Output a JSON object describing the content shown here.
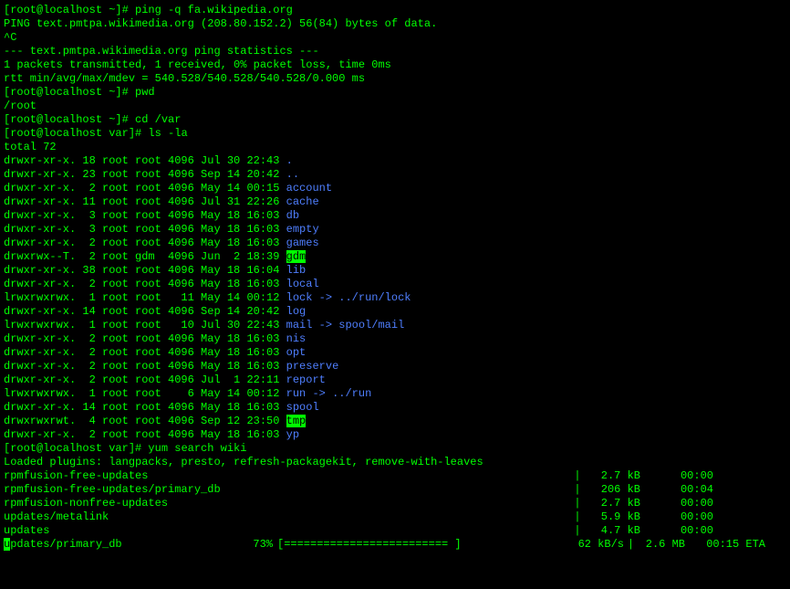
{
  "prompt_home": "[root@localhost ~]#",
  "prompt_var": "[root@localhost var]#",
  "cmd_ping": " ping -q fa.wikipedia.org",
  "ping_header": "PING text.pmtpa.wikimedia.org (208.80.152.2) 56(84) bytes of data.",
  "ctrl_c": "^C",
  "ping_stats_header": "--- text.pmtpa.wikimedia.org ping statistics ---",
  "ping_stats1": "1 packets transmitted, 1 received, 0% packet loss, time 0ms",
  "ping_stats2": "rtt min/avg/max/mdev = 540.528/540.528/540.528/0.000 ms",
  "cmd_pwd": " pwd",
  "pwd_out": "/root",
  "cmd_cd": " cd /var",
  "cmd_ls": " ls -la",
  "total": "total 72",
  "ls": [
    {
      "perm": "drwxr-xr-x. 18 root root 4096 Jul 30 22:43 ",
      "name": ".",
      "type": "dir"
    },
    {
      "perm": "drwxr-xr-x. 23 root root 4096 Sep 14 20:42 ",
      "name": "..",
      "type": "dir"
    },
    {
      "perm": "drwxr-xr-x.  2 root root 4096 May 14 00:15 ",
      "name": "account",
      "type": "dir"
    },
    {
      "perm": "drwxr-xr-x. 11 root root 4096 Jul 31 22:26 ",
      "name": "cache",
      "type": "dir"
    },
    {
      "perm": "drwxr-xr-x.  3 root root 4096 May 18 16:03 ",
      "name": "db",
      "type": "dir"
    },
    {
      "perm": "drwxr-xr-x.  3 root root 4096 May 18 16:03 ",
      "name": "empty",
      "type": "dir"
    },
    {
      "perm": "drwxr-xr-x.  2 root root 4096 May 18 16:03 ",
      "name": "games",
      "type": "dir"
    },
    {
      "perm": "drwxrwx--T.  2 root gdm  4096 Jun  2 18:39 ",
      "name": "gdm",
      "type": "hl"
    },
    {
      "perm": "drwxr-xr-x. 38 root root 4096 May 18 16:04 ",
      "name": "lib",
      "type": "dir"
    },
    {
      "perm": "drwxr-xr-x.  2 root root 4096 May 18 16:03 ",
      "name": "local",
      "type": "dir"
    },
    {
      "perm": "lrwxrwxrwx.  1 root root   11 May 14 00:12 ",
      "name": "lock",
      "type": "dir",
      "suffix": " -> ../run/lock"
    },
    {
      "perm": "drwxr-xr-x. 14 root root 4096 Sep 14 20:42 ",
      "name": "log",
      "type": "dir"
    },
    {
      "perm": "lrwxrwxrwx.  1 root root   10 Jul 30 22:43 ",
      "name": "mail",
      "type": "dir",
      "suffix": " -> spool/mail"
    },
    {
      "perm": "drwxr-xr-x.  2 root root 4096 May 18 16:03 ",
      "name": "nis",
      "type": "dir"
    },
    {
      "perm": "drwxr-xr-x.  2 root root 4096 May 18 16:03 ",
      "name": "opt",
      "type": "dir"
    },
    {
      "perm": "drwxr-xr-x.  2 root root 4096 May 18 16:03 ",
      "name": "preserve",
      "type": "dir"
    },
    {
      "perm": "drwxr-xr-x.  2 root root 4096 Jul  1 22:11 ",
      "name": "report",
      "type": "dir"
    },
    {
      "perm": "lrwxrwxrwx.  1 root root    6 May 14 00:12 ",
      "name": "run",
      "type": "dir",
      "suffix": " -> ../run"
    },
    {
      "perm": "drwxr-xr-x. 14 root root 4096 May 18 16:03 ",
      "name": "spool",
      "type": "dir"
    },
    {
      "perm": "drwxrwxrwt.  4 root root 4096 Sep 12 23:50 ",
      "name": "tmp",
      "type": "hl"
    },
    {
      "perm": "drwxr-xr-x.  2 root root 4096 May 18 16:03 ",
      "name": "yp",
      "type": "dir"
    }
  ],
  "cmd_yum": " yum search wiki",
  "yum_plugins": "Loaded plugins: langpacks, presto, refresh-packagekit, remove-with-leaves",
  "repos": [
    {
      "name": "rpmfusion-free-updates",
      "size": "2.7 kB",
      "time": "00:00"
    },
    {
      "name": "rpmfusion-free-updates/primary_db",
      "size": "206 kB",
      "time": "00:04"
    },
    {
      "name": "rpmfusion-nonfree-updates",
      "size": "2.7 kB",
      "time": "00:00"
    },
    {
      "name": "updates/metalink",
      "size": "5.9 kB",
      "time": "00:00"
    },
    {
      "name": "updates",
      "size": "4.7 kB",
      "time": "00:00"
    }
  ],
  "progress": {
    "label_a": "u",
    "label_b": "pdates/primary_db",
    "pct": "73%",
    "bar": "[=========================     ]",
    "speed": "62 kB/s",
    "sep": "|",
    "size": "2.6 MB",
    "eta": "00:15 ETA"
  },
  "bar_char": "|"
}
